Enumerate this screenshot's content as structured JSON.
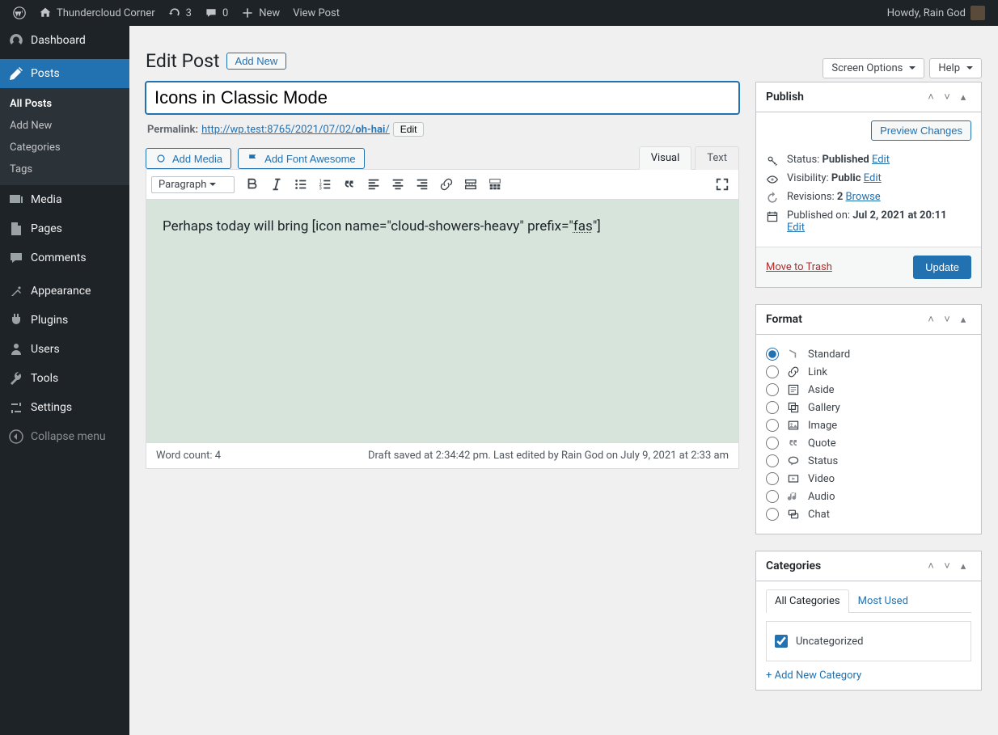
{
  "adminbar": {
    "site_name": "Thundercloud Corner",
    "updates_count": "3",
    "comments_count": "0",
    "new_label": "New",
    "view_post": "View Post",
    "howdy": "Howdy, Rain God"
  },
  "sidebar": {
    "dashboard": "Dashboard",
    "posts": "Posts",
    "posts_sub": {
      "all": "All Posts",
      "add": "Add New",
      "cats": "Categories",
      "tags": "Tags"
    },
    "media": "Media",
    "pages": "Pages",
    "comments": "Comments",
    "appearance": "Appearance",
    "plugins": "Plugins",
    "users": "Users",
    "tools": "Tools",
    "settings": "Settings",
    "collapse": "Collapse menu"
  },
  "top_tabs": {
    "screen_options": "Screen Options",
    "help": "Help"
  },
  "page": {
    "heading": "Edit Post",
    "add_new": "Add New",
    "title_value": "Icons in Classic Mode",
    "permalink_label": "Permalink:",
    "permalink_base": "http://wp.test:8765/2021/07/02/",
    "permalink_slug": "oh-hai",
    "permalink_suffix": "/",
    "edit_btn": "Edit",
    "add_media": "Add Media",
    "add_fa": "Add Font Awesome",
    "tab_visual": "Visual",
    "tab_text": "Text",
    "format_select": "Paragraph",
    "body_text_pre": "Perhaps today will bring [icon name=\"cloud-showers-heavy\" prefix=\"",
    "body_text_sq": "fas",
    "body_text_post": "\"]",
    "word_count": "Word count: 4",
    "foot_status": "Draft saved at 2:34:42 pm. Last edited by Rain God on July 9, 2021 at 2:33 am"
  },
  "publish": {
    "heading": "Publish",
    "preview": "Preview Changes",
    "status_label": "Status: ",
    "status_value": "Published",
    "visibility_label": "Visibility: ",
    "visibility_value": "Public",
    "revisions_label": "Revisions: ",
    "revisions_value": "2",
    "browse": "Browse",
    "published_label": "Published on: ",
    "published_value": "Jul 2, 2021 at 20:11",
    "edit": "Edit",
    "trash": "Move to Trash",
    "update": "Update"
  },
  "format": {
    "heading": "Format",
    "items": [
      "Standard",
      "Link",
      "Aside",
      "Gallery",
      "Image",
      "Quote",
      "Status",
      "Video",
      "Audio",
      "Chat"
    ],
    "selected": 0
  },
  "categories": {
    "heading": "Categories",
    "tab_all": "All Categories",
    "tab_most": "Most Used",
    "uncategorized": "Uncategorized",
    "add_new": "+ Add New Category"
  }
}
